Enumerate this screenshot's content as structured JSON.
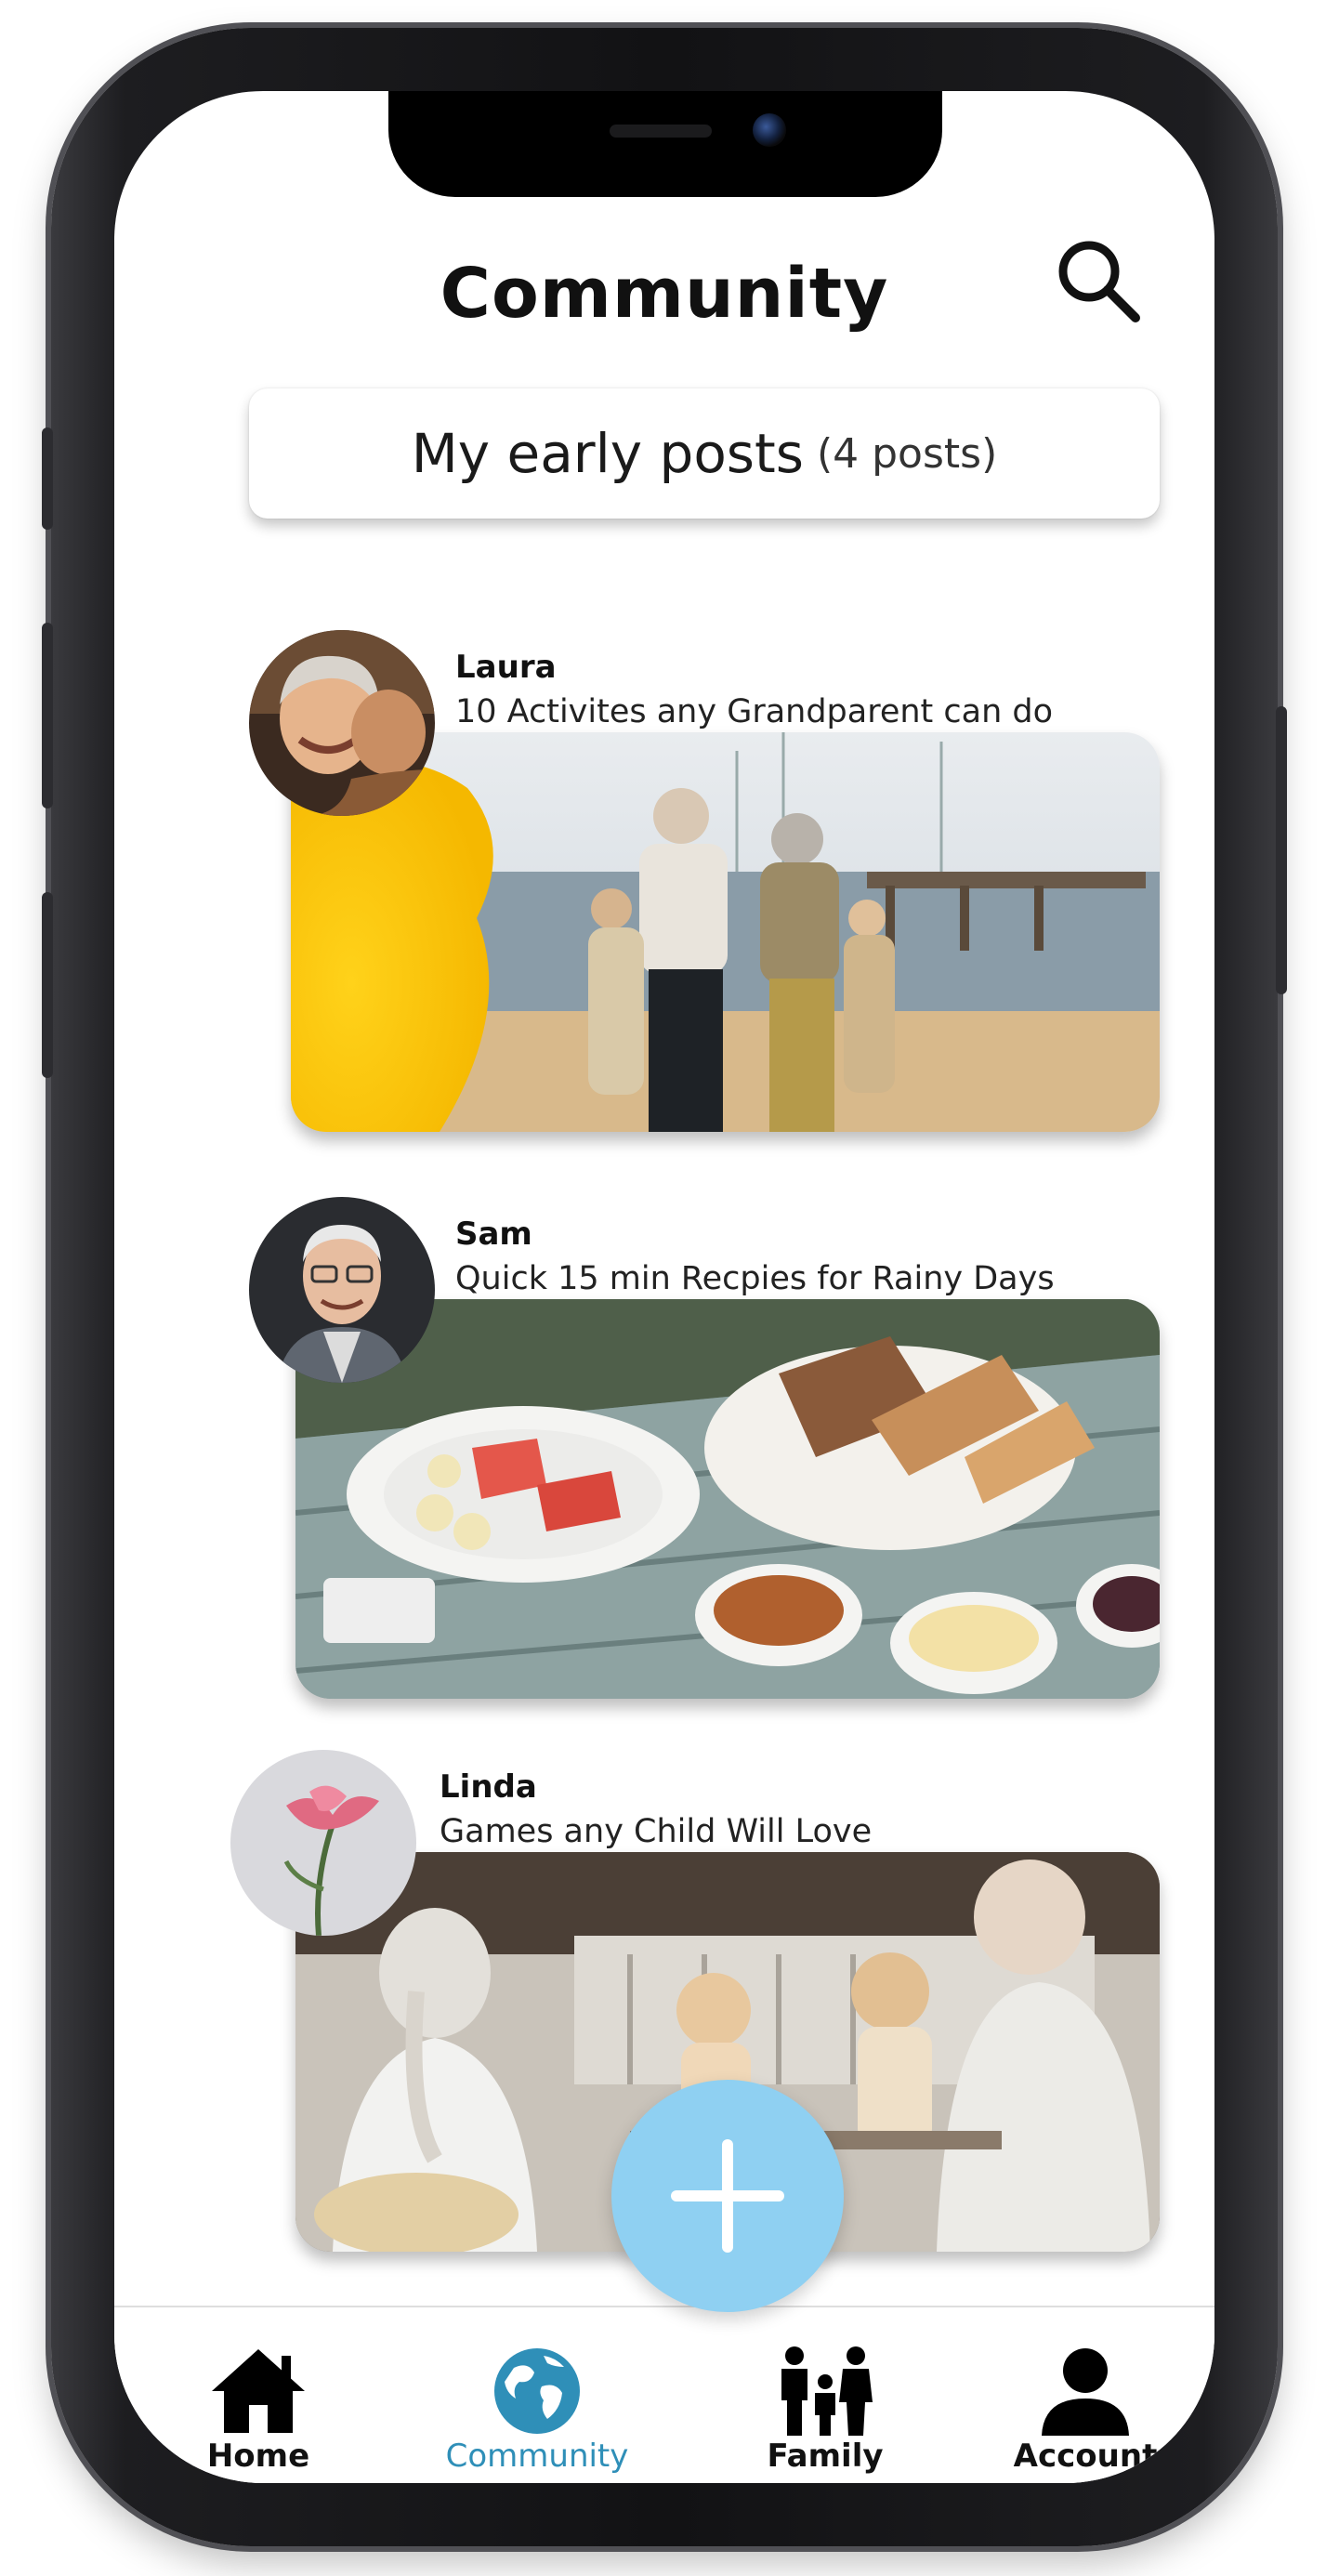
{
  "header": {
    "title": "Community"
  },
  "posts_summary": {
    "label": "My early posts",
    "count_text": "(4 posts)"
  },
  "posts": [
    {
      "author": "Laura",
      "title": "10 Activites any Grandparent can do"
    },
    {
      "author": "Sam",
      "title": "Quick 15 min Recpies for Rainy Days"
    },
    {
      "author": "Linda",
      "title": "Games any Child Will Love"
    }
  ],
  "bottom_nav": {
    "items": [
      {
        "label": "Home",
        "icon": "house-icon"
      },
      {
        "label": "Community",
        "icon": "globe-icon",
        "active": true
      },
      {
        "label": "Family",
        "icon": "family-icon"
      },
      {
        "label": "Account",
        "icon": "person-icon"
      }
    ]
  },
  "colors": {
    "accent": "#2f8fb8",
    "fab": "#8fd0f2",
    "text": "#111111"
  }
}
